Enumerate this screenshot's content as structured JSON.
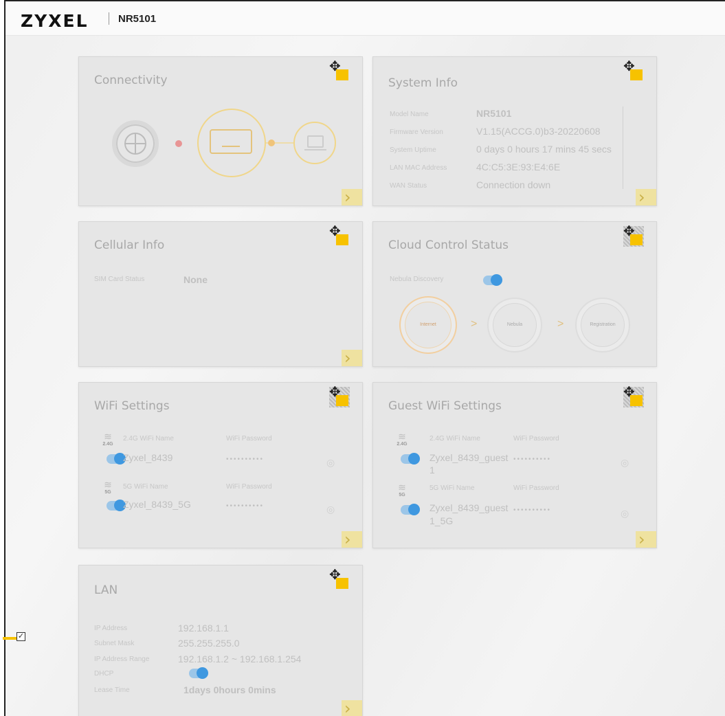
{
  "header": {
    "brand": "ZYXEL",
    "model": "NR5101",
    "menu_icon": "≡"
  },
  "connectivity": {
    "title": "Connectivity"
  },
  "system_info": {
    "title": "System Info",
    "rows": [
      {
        "label": "Model Name",
        "value": "NR5101"
      },
      {
        "label": "Firmware Version",
        "value": "V1.15(ACCG.0)b3-20220608"
      },
      {
        "label": "System Uptime",
        "value": "0 days 0 hours 17 mins 45 secs"
      },
      {
        "label": "LAN MAC Address",
        "value": "4C:C5:3E:93:E4:6E"
      },
      {
        "label": "WAN Status",
        "value": "Connection down"
      }
    ]
  },
  "cellular_info": {
    "title": "Cellular Info",
    "sim_label": "SIM Card Status",
    "sim_value": "None"
  },
  "cloud": {
    "title": "Cloud Control Status",
    "nebula_label": "Nebula Discovery",
    "steps": [
      "Internet",
      "Nebula",
      "Registration"
    ]
  },
  "wifi": {
    "title": "WiFi Settings",
    "bands": [
      {
        "band": "2.4G",
        "name_label": "2.4G WiFi Name",
        "name": "Zyxel_8439",
        "pw_label": "WiFi Password",
        "pw": "••••••••••"
      },
      {
        "band": "5G",
        "name_label": "5G WiFi Name",
        "name": "Zyxel_8439_5G",
        "pw_label": "WiFi Password",
        "pw": "••••••••••"
      }
    ]
  },
  "guest_wifi": {
    "title": "Guest WiFi Settings",
    "bands": [
      {
        "band": "2.4G",
        "name_label": "2.4G WiFi Name",
        "name_line1": "Zyxel_8439_guest",
        "name_line2": "1",
        "pw_label": "WiFi Password",
        "pw": "••••••••••"
      },
      {
        "band": "5G",
        "name_label": "5G WiFi Name",
        "name_line1": "Zyxel_8439_guest",
        "name_line2": "1_5G",
        "pw_label": "WiFi Password",
        "pw": "••••••••••"
      }
    ]
  },
  "lan": {
    "title": "LAN",
    "rows": [
      {
        "label": "IP Address",
        "value": "192.168.1.1"
      },
      {
        "label": "Subnet Mask",
        "value": "255.255.255.0"
      },
      {
        "label": "IP Address Range",
        "value": "192.168.1.2 ~ 192.168.1.254"
      },
      {
        "label": "DHCP",
        "value": ""
      },
      {
        "label": "Lease Time",
        "value": "1days 0hours 0mins"
      }
    ]
  },
  "icons": {
    "move": "✥",
    "next": "›",
    "eye": "◎",
    "check": "✓"
  },
  "colors": {
    "accent": "#f7c200",
    "toggle": "#3f98e0"
  }
}
